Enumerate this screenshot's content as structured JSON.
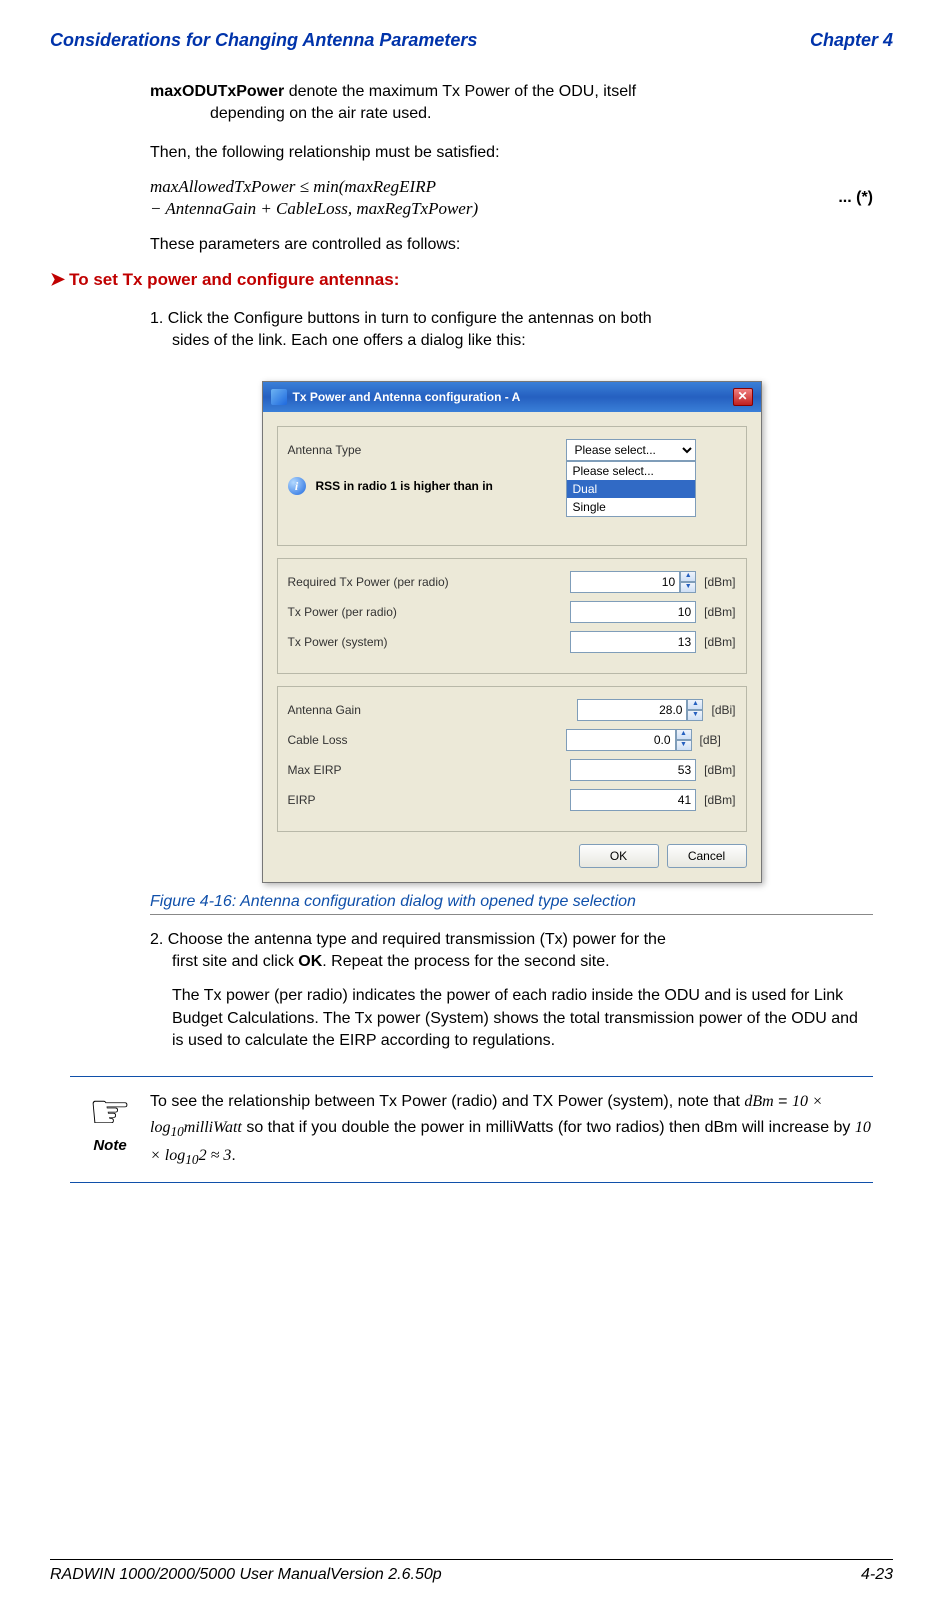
{
  "header": {
    "left": "Considerations for Changing Antenna Parameters",
    "right": "Chapter 4"
  },
  "maxOduTerm": "maxODUTxPower",
  "maxOduDesc1": " denote the maximum Tx Power of the ODU, itself",
  "maxOduDesc2": "depending on the air rate used.",
  "relMust": "Then, the following relationship must be satisfied:",
  "formula1": "maxAllowedTxPower ≤ min(maxRegEIRP",
  "formula2": " − AntennaGain + CableLoss, maxRegTxPower)",
  "formulaMarker": "... (*)",
  "paramsControlled": "These parameters are controlled as follows:",
  "actionHeading": "To set Tx power and configure antennas:",
  "step1a": "1. Click the Configure buttons in turn to configure the antennas on both",
  "step1b": "sides of the link. Each one offers a dialog like this:",
  "dialog": {
    "title": "Tx Power and Antenna configuration - A",
    "antennaTypeLabel": "Antenna Type",
    "antennaTypeSelected": "Please select...",
    "dropdown": {
      "opt1": "Please select...",
      "opt2": "Dual",
      "opt3": "Single"
    },
    "rssInfo": "RSS in radio 1 is higher than in",
    "reqTxLabel": "Required Tx Power (per radio)",
    "reqTxVal": "10",
    "txPerRadioLabel": "Tx Power (per radio)",
    "txPerRadioVal": "10",
    "txSystemLabel": "Tx Power (system)",
    "txSystemVal": "13",
    "antGainLabel": "Antenna Gain",
    "antGainVal": "28.0",
    "cableLossLabel": "Cable Loss",
    "cableLossVal": "0.0",
    "maxEirpLabel": "Max EIRP",
    "maxEirpVal": "53",
    "eirpLabel": "EIRP",
    "eirpVal": "41",
    "unit_dBm": "[dBm]",
    "unit_dBi": "[dBi]",
    "unit_dB": "[dB]",
    "okLabel": "OK",
    "cancelLabel": "Cancel"
  },
  "figureCaption": "Figure 4-16:  Antenna configuration dialog with opened type selection",
  "step2a": "2. Choose the antenna type and required transmission (Tx) power for the",
  "step2b": "first site and click ",
  "step2bold": "OK",
  "step2c": ". Repeat the process for the second site.",
  "step2para": "The Tx power (per radio) indicates the power of each radio inside the ODU and is used for Link Budget Calculations. The Tx power (System) shows the total transmission power of the ODU and is used to calculate the EIRP according to regulations.",
  "noteLabel": "Note",
  "note": {
    "t1": "To see the relationship between Tx Power (radio) and TX Power (system), note that ",
    "math1a": "dBm",
    "math1eq": " = ",
    "math1b": "10 × log",
    "math1sub": "10",
    "math1c": "milliWatt",
    "t2": " so that if you double the power in milliWatts (for two radios) then dBm will increase by ",
    "math2a": "10 × log",
    "math2sub": "10",
    "math2b": "2 ≈ 3",
    "t3": "."
  },
  "footer": {
    "left": "RADWIN 1000/2000/5000 User ManualVersion  2.6.50p",
    "right": "4-23"
  }
}
